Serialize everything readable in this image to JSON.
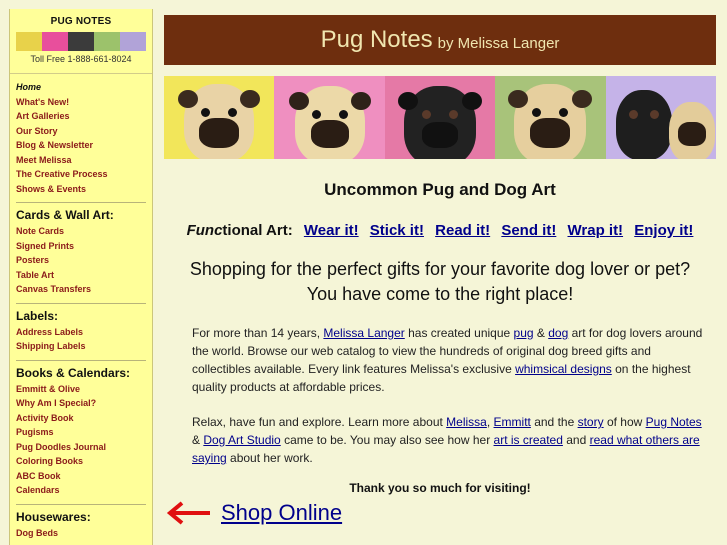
{
  "sidebar": {
    "brand_title": "PUG NOTES",
    "brand_strip_colors": [
      "#e8d24a",
      "#e84f9c",
      "#3b3b3b",
      "#9cc26b",
      "#b1a3d8"
    ],
    "tollfree": "Toll Free 1-888-661-8024",
    "nav_main": [
      "Home",
      "What's New!",
      "Art Galleries",
      "Our Story",
      "Blog & Newsletter",
      "Meet Melissa",
      "The Creative Process",
      "Shows & Events"
    ],
    "cards_heading": "Cards & Wall Art:",
    "cards_items": [
      "Note Cards",
      "Signed Prints",
      "Posters",
      "Table Art",
      "Canvas Transfers"
    ],
    "labels_heading": "Labels:",
    "labels_items": [
      "Address Labels",
      "Shipping Labels"
    ],
    "books_heading": "Books & Calendars:",
    "books_items": [
      "Emmitt & Olive",
      "Why Am I Special?",
      "Activity Book",
      "Pugisms",
      "Pug Doodles Journal",
      "Coloring Books",
      "ABC Book",
      "Calendars"
    ],
    "housewares_heading": "Housewares:",
    "housewares_items": [
      "Dog Beds"
    ]
  },
  "header": {
    "title": "Pug Notes",
    "byline": "by Melissa Langer"
  },
  "banner": {
    "panel_colors": [
      "#f2e65a",
      "#ef8fc0",
      "#e579a6",
      "#a8c37a",
      "#c5b3e8"
    ]
  },
  "content": {
    "headline": "Uncommon Pug and Dog Art",
    "functional_label_em": "Func",
    "functional_label_rest": "tional Art:",
    "functional_links": [
      "Wear it!",
      "Stick it!",
      "Read it!",
      "Send it!",
      "Wrap it!",
      "Enjoy it!"
    ],
    "shopping_line1": "Shopping for the perfect gifts for your favorite dog lover or pet?",
    "shopping_line2": "You have come to the right place!",
    "para1": {
      "t1": "For more than 14 years, ",
      "link_melissa": "Melissa Langer",
      "t2": " has created unique ",
      "link_pug": "pug",
      "t3": " & ",
      "link_dog": "dog",
      "t4": " art for dog lovers around the world. Browse our web catalog to view the hundreds of original dog breed gifts and collectibles available. Every link features Melissa's exclusive ",
      "link_whimsical": "whimsical designs",
      "t5": " on the highest quality products at affordable prices."
    },
    "para2": {
      "t1": "Relax, have fun and explore. Learn more about ",
      "link_melissa": "Melissa",
      "t2": ", ",
      "link_emmitt": "Emmitt",
      "t3": " and the ",
      "link_story": "story",
      "t4": " of how ",
      "link_pugnotes": "Pug Notes",
      "t5": " & ",
      "link_studio": "Dog Art Studio",
      "t6": " came to be. You may also see how her ",
      "link_created": "art is created",
      "t7": " and ",
      "link_others": "read what others are saying",
      "t8": " about her work."
    },
    "thanks": "Thank you so much for visiting!",
    "shop_online": "Shop Online"
  },
  "colors": {
    "sidebar_bg": "#ffff99",
    "header_bg": "#6e2e0e",
    "link": "#00008b",
    "nav_link": "#8b1a1a",
    "arrow": "#e01010"
  }
}
